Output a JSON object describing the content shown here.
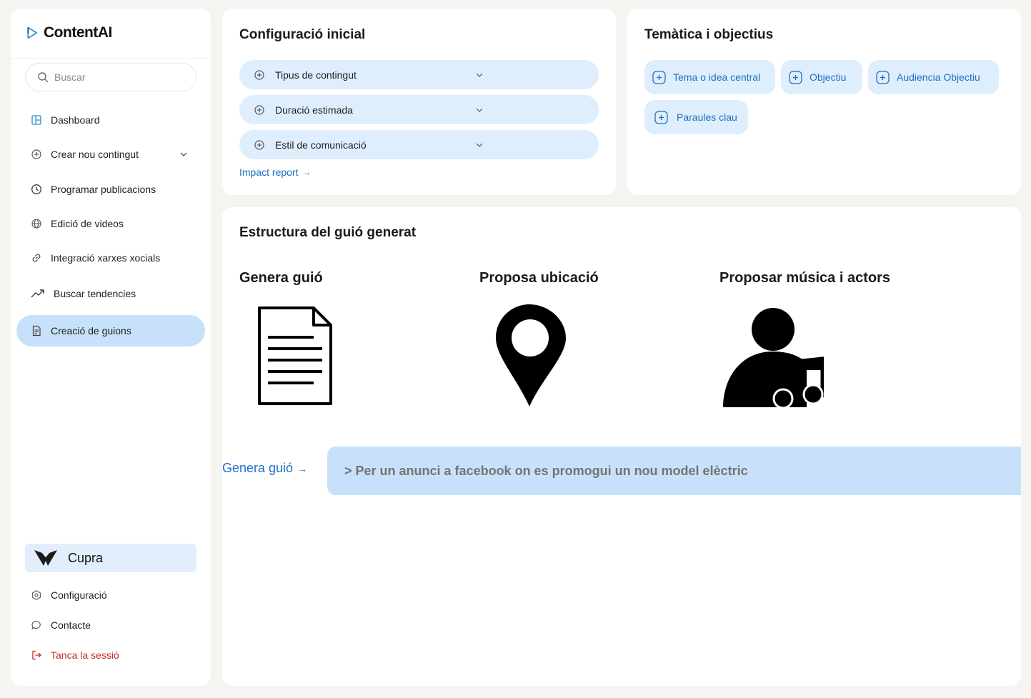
{
  "app": {
    "name": "ContentAI",
    "brand_color": "#2a8fd6"
  },
  "sidebar": {
    "search_placeholder": "Buscar",
    "items": [
      {
        "label": "Dashboard",
        "icon": "dashboard-icon"
      },
      {
        "label": "Crear nou contingut",
        "icon": "plus-circle-icon",
        "has_submenu": true
      },
      {
        "label": "Programar publicacions",
        "icon": "clock-icon"
      },
      {
        "label": "Edició de videos",
        "icon": "globe-icon"
      },
      {
        "label": "Integració xarxes xocials",
        "icon": "link-icon"
      },
      {
        "label": "Buscar tendencies",
        "icon": "trending-up-icon"
      },
      {
        "label": "Creació de guions",
        "icon": "document-icon",
        "active": true
      }
    ],
    "workspace": {
      "label": "Cupra",
      "icon": "cupra-logo-icon"
    },
    "footer": [
      {
        "label": "Configuració",
        "icon": "settings-icon"
      },
      {
        "label": "Contacte",
        "icon": "chat-icon"
      },
      {
        "label": "Tanca la sessió",
        "icon": "logout-icon",
        "color": "#c62828"
      }
    ]
  },
  "config": {
    "title": "Configuració inicial",
    "selects": [
      {
        "label": "Tipus de contingut"
      },
      {
        "label": "Duració estimada"
      },
      {
        "label": "Estil de comunicació"
      }
    ],
    "link": "Impact report"
  },
  "topics": {
    "title": "Temàtica i objectius",
    "chips": [
      "Tema o idea central",
      "Objectiu",
      "Audiencia Objectiu",
      "Paraules clau"
    ]
  },
  "structure": {
    "title": "Estructura del guió generat",
    "columns": [
      {
        "title": "Genera guió",
        "icon": "document-icon"
      },
      {
        "title": "Proposa ubicació",
        "icon": "map-pin-icon"
      },
      {
        "title": "Proposar música i actors",
        "icon": "person-music-icon"
      }
    ],
    "action_link": "Genera guió",
    "prompt": "> Per un anunci a facebook on es promogui un nou model elèctric"
  }
}
